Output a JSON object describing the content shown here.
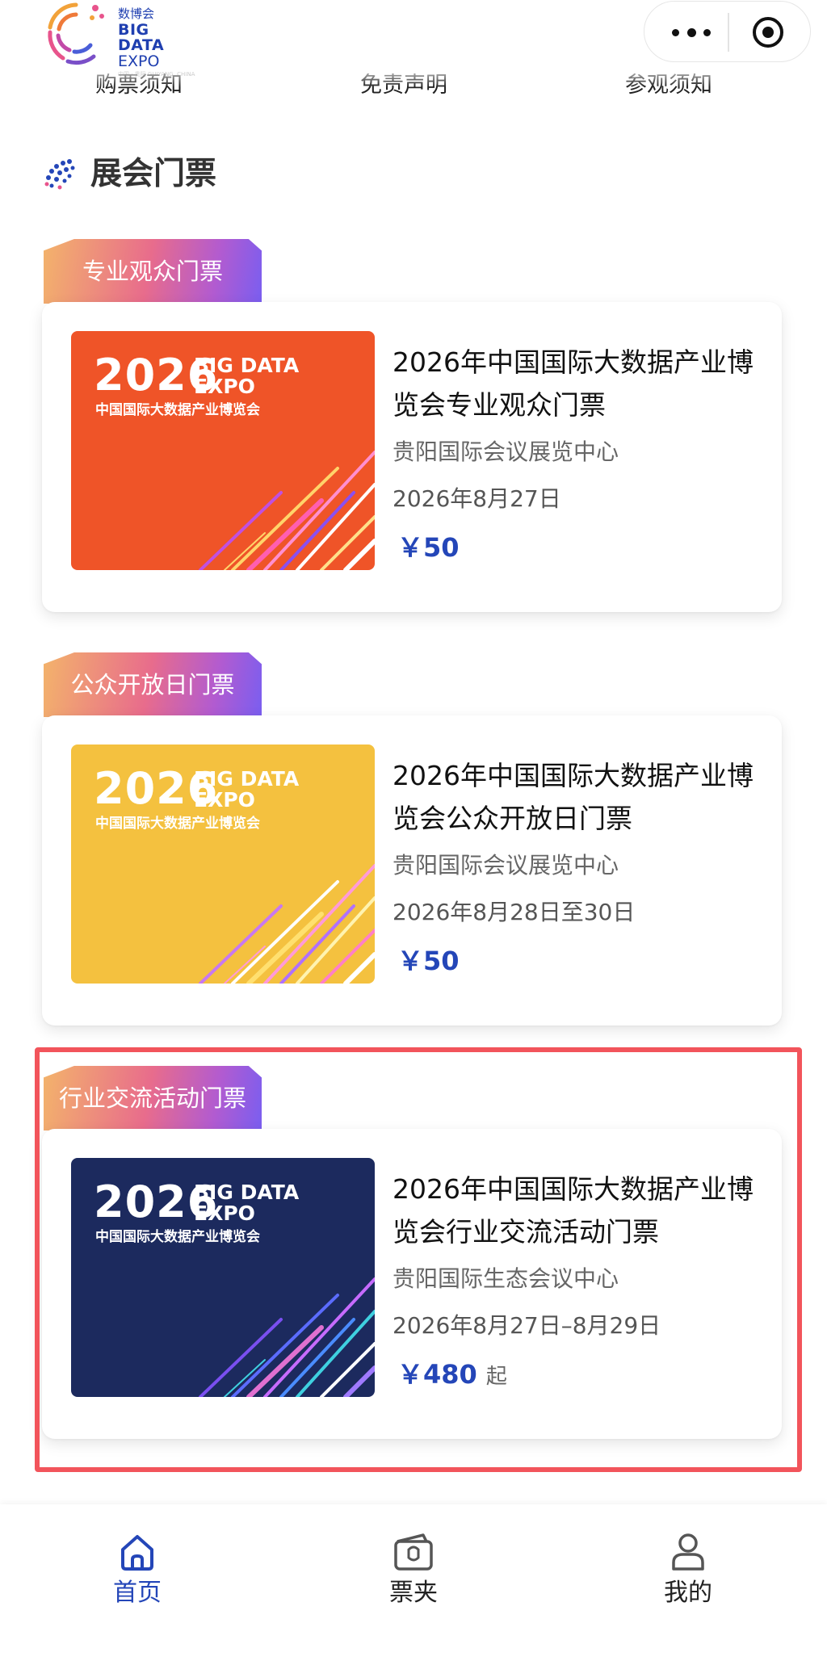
{
  "header": {
    "logo": {
      "cn": "数博会",
      "en_line1": "BIG DATA",
      "en_line2": "EXPO",
      "small": "中国 · 贵阳 GUIYANG, CHINA"
    },
    "links": [
      "购票须知",
      "免责声明",
      "参观须知"
    ]
  },
  "section": {
    "title": "展会门票"
  },
  "tickets": [
    {
      "tag": "专业观众门票",
      "poster": {
        "year": "2026",
        "brand1": "BIG DATA",
        "brand2": "EXPO",
        "cn": "中国国际大数据产业博览会",
        "bg": "#ef5428"
      },
      "title": "2026年中国国际大数据产业博览会专业观众门票",
      "venue": "贵阳国际会议展览中心",
      "date": "2026年8月27日",
      "price": "￥50",
      "price_suffix": ""
    },
    {
      "tag": "公众开放日门票",
      "poster": {
        "year": "2026",
        "brand1": "BIG DATA",
        "brand2": "EXPO",
        "cn": "中国国际大数据产业博览会",
        "bg": "#f4c13f"
      },
      "title": "2026年中国国际大数据产业博览会公众开放日门票",
      "venue": "贵阳国际会议展览中心",
      "date": "2026年8月28日至30日",
      "price": "￥50",
      "price_suffix": ""
    },
    {
      "tag": "行业交流活动门票",
      "poster": {
        "year": "2026",
        "brand1": "BIG DATA",
        "brand2": "EXPO",
        "cn": "中国国际大数据产业博览会",
        "bg": "#1c2a5e"
      },
      "title": "2026年中国国际大数据产业博览会行业交流活动门票",
      "venue": "贵阳国际生态会议中心",
      "date": "2026年8月27日–8月29日",
      "price": "￥480",
      "price_suffix": "起"
    }
  ],
  "tabbar": [
    {
      "label": "首页",
      "icon": "home-icon",
      "active": true
    },
    {
      "label": "票夹",
      "icon": "ticket-wallet-icon",
      "active": false
    },
    {
      "label": "我的",
      "icon": "user-icon",
      "active": false
    }
  ],
  "colors": {
    "accent": "#2446b8",
    "highlight_border": "#f2545b",
    "tag_gradient": [
      "#f3b36b",
      "#e86c8c",
      "#b25bd0",
      "#7a5ef0"
    ]
  }
}
